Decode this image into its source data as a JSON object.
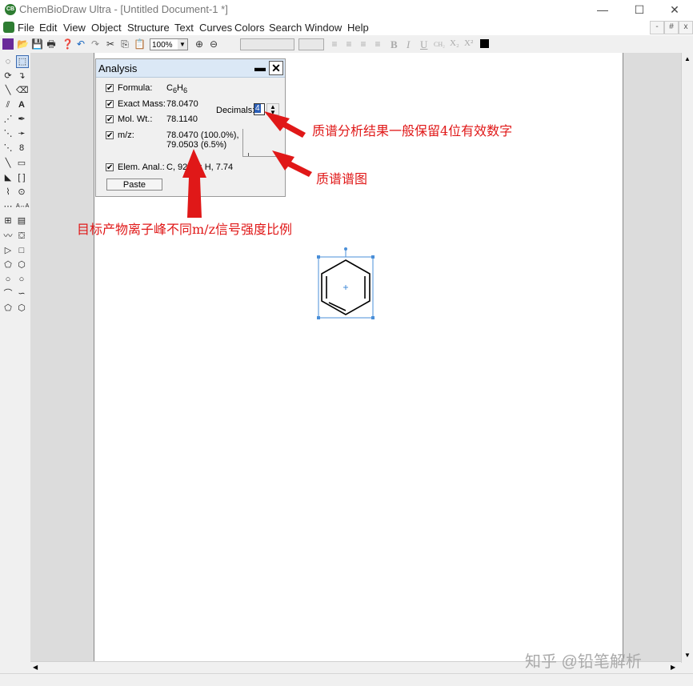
{
  "window": {
    "title": "ChemBioDraw Ultra - [Untitled Document-1 *]",
    "minimize": "—",
    "maximize": "☐",
    "close": "✕"
  },
  "menu": {
    "items": [
      "File",
      "Edit",
      "View",
      "Object",
      "Structure",
      "Text",
      "Curves",
      "Colors",
      "Search",
      "Window",
      "Help"
    ],
    "mdi_minimize": "-",
    "mdi_restore": "#",
    "mdi_close": "x"
  },
  "toolbar": {
    "zoom_value": "100%",
    "bold": "B",
    "italic": "I",
    "underline": "U",
    "subscript_formula": "CH₂",
    "subscript": "X₂",
    "superscript": "X²"
  },
  "analysis": {
    "title": "Analysis",
    "formula_label": "Formula:",
    "formula_value_c": "C",
    "formula_value_c_sub": "6",
    "formula_value_h": "H",
    "formula_value_h_sub": "6",
    "exact_mass_label": "Exact Mass:",
    "exact_mass_value": "78.0470",
    "mol_wt_label": "Mol. Wt.:",
    "mol_wt_value": "78.1140",
    "mz_label": "m/z:",
    "mz_value_1": "78.0470 (100.0%),",
    "mz_value_2": "79.0503 (6.5%)",
    "decimals_label": "Decimals:",
    "decimals_value": "4",
    "elem_anal_label": "Elem. Anal.:",
    "elem_anal_value": "C, 92.26; H, 7.74",
    "paste_label": "Paste"
  },
  "annotations": {
    "decimals_note": "质谱分析结果一般保留4位有效数字",
    "spectrum_note": "质谱谱图",
    "mz_note": "目标产物离子峰不同m/z信号强度比例",
    "color": "#e01818"
  },
  "watermark": "知乎 @铅笔解析",
  "icons": {
    "check": "✔",
    "search": "🔍"
  }
}
